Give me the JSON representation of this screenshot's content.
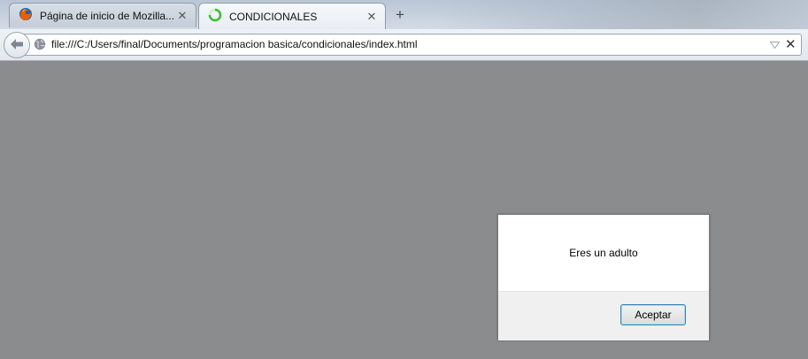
{
  "tabs": [
    {
      "title": "Página de inicio de Mozilla...",
      "close": "✕",
      "icon": "firefox-icon",
      "active": false
    },
    {
      "title": "CONDICIONALES",
      "close": "✕",
      "icon": "loading-spinner-icon",
      "active": true
    }
  ],
  "new_tab_label": "+",
  "navbar": {
    "url": "file:///C:/Users/final/Documents/programacion basica/condicionales/index.html",
    "stop_label": "✕"
  },
  "alert": {
    "message": "Eres un adulto",
    "ok_label": "Aceptar"
  },
  "colors": {
    "content_background": "#8b8c8e",
    "dialog_footer": "#f0f0f0",
    "button_focus": "#3c7fb1"
  }
}
